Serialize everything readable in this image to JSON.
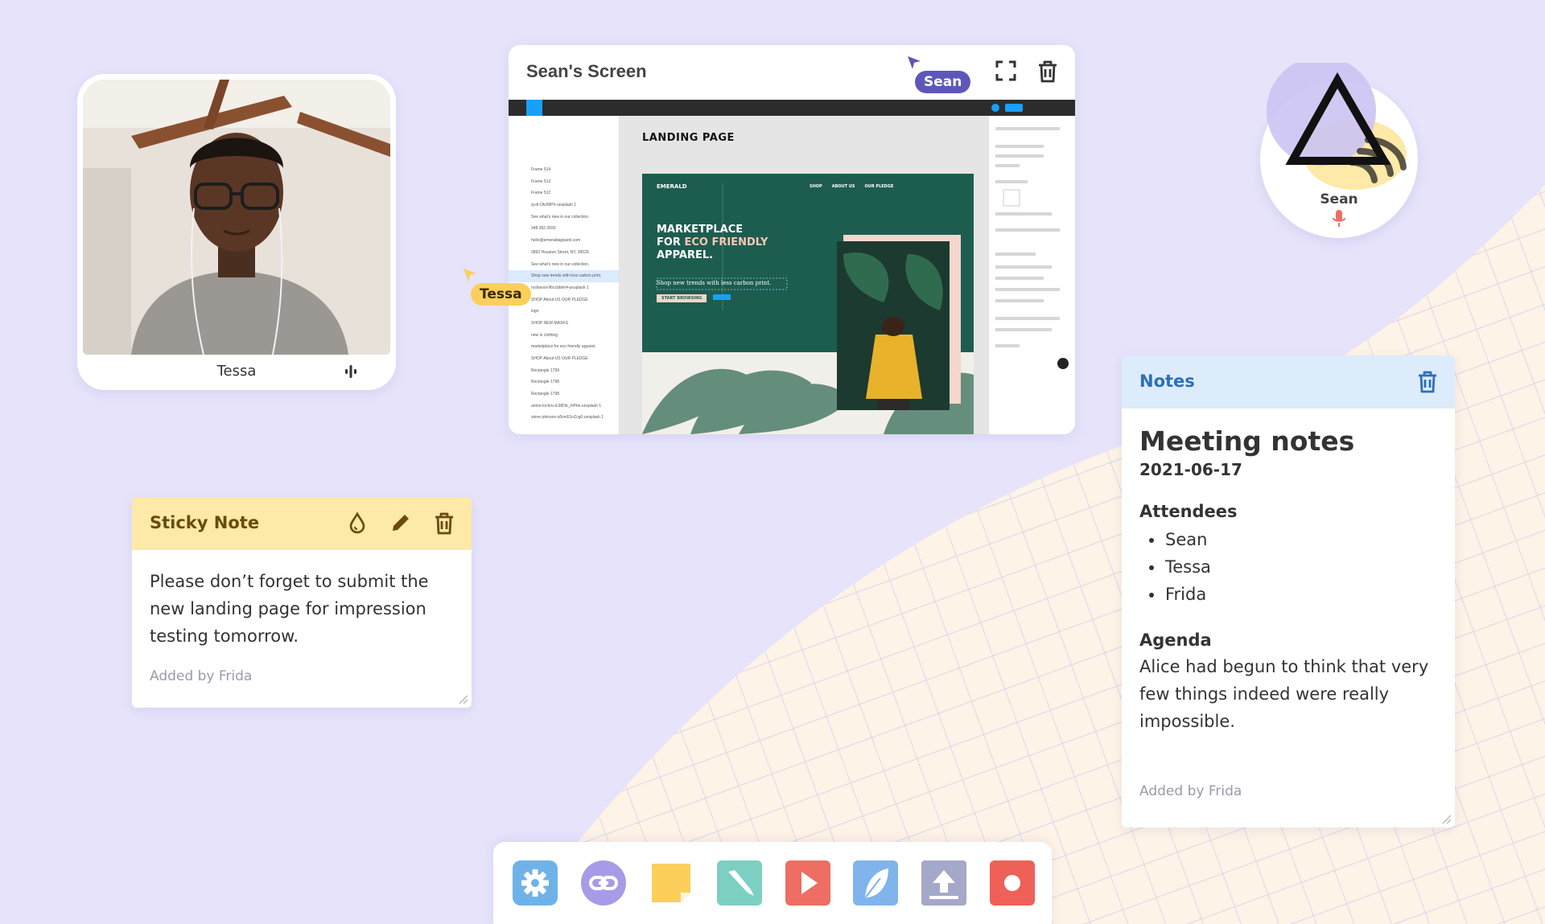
{
  "video": {
    "name": "Tessa"
  },
  "screen": {
    "title": "Sean's Screen",
    "cursor_label": "Sean",
    "figma": {
      "landing_title": "LANDING PAGE",
      "layers": [
        "Frame 514",
        "Frame 513",
        "Frame 512",
        "sj-di-Ofv58Ph-unsplash 1",
        "See what's new in our collection.",
        "348.392.2693",
        "hello@emeraldapparel.com",
        "3892 Houston Street, NY, 39529",
        "See what's new in our collection.",
        "Shop new trends with less carbon print.",
        "rockwool-96ccbbnh4-unsplash 1",
        "SHOP About US OUR PLEDGE",
        "logo",
        "SHOP NEW MASKS",
        "new in clothing",
        "marketplace for eco friendly apparel.",
        "SHOP About US OUR PLEDGE",
        "Rectangle 1799",
        "Rectangle 1798",
        "Rectangle 1798",
        "anton-lochov-E38Db_rhPkk-unsplash 1",
        "steve-johnson-s8vm51nZcg0-unsplash 1"
      ],
      "brand": "EMERALD",
      "nav": [
        "SHOP",
        "ABOUT US",
        "OUR PLEDGE"
      ],
      "headline_1": "MARKETPLACE",
      "headline_2": "FOR",
      "headline_2b": "ECO FRIENDLY",
      "headline_3": "APPAREL.",
      "tagline": "Shop new trends with less carbon print.",
      "cta": "START BROWSING"
    }
  },
  "tessa_cursor": {
    "label": "Tessa"
  },
  "avatar": {
    "name": "Sean"
  },
  "sticky": {
    "title": "Sticky Note",
    "body": "Please don’t forget to submit the new landing page for impression testing tomorrow.",
    "added_by": "Added by Frida"
  },
  "notes": {
    "title": "Notes",
    "heading": "Meeting notes",
    "date": "2021-06-17",
    "attendees_title": "Attendees",
    "attendees": [
      "Sean",
      "Tessa",
      "Frida"
    ],
    "agenda_title": "Agenda",
    "agenda_text": "Alice had begun to think that very few things indeed were really impossible.",
    "added_by": "Added by Frida"
  },
  "dock": {
    "items": [
      {
        "name": "settings",
        "color": "#6fb2e8"
      },
      {
        "name": "link",
        "color": "#a79be8"
      },
      {
        "name": "sticky-note",
        "color": "#fbcf5a"
      },
      {
        "name": "pen",
        "color": "#7dcfc2"
      },
      {
        "name": "video",
        "color": "#ee6e63"
      },
      {
        "name": "feather",
        "color": "#7fb4ec"
      },
      {
        "name": "upload",
        "color": "#a4a8c9"
      },
      {
        "name": "record",
        "color": "#ef6058"
      }
    ]
  },
  "colors": {
    "background": "#e6e3fb",
    "accent_purple": "#5e57b8",
    "tessa_yellow": "#fbcf5a",
    "sticky_header": "#fde9a8",
    "notes_header": "#dcecfb",
    "emerald_green": "#1d5d4f"
  }
}
